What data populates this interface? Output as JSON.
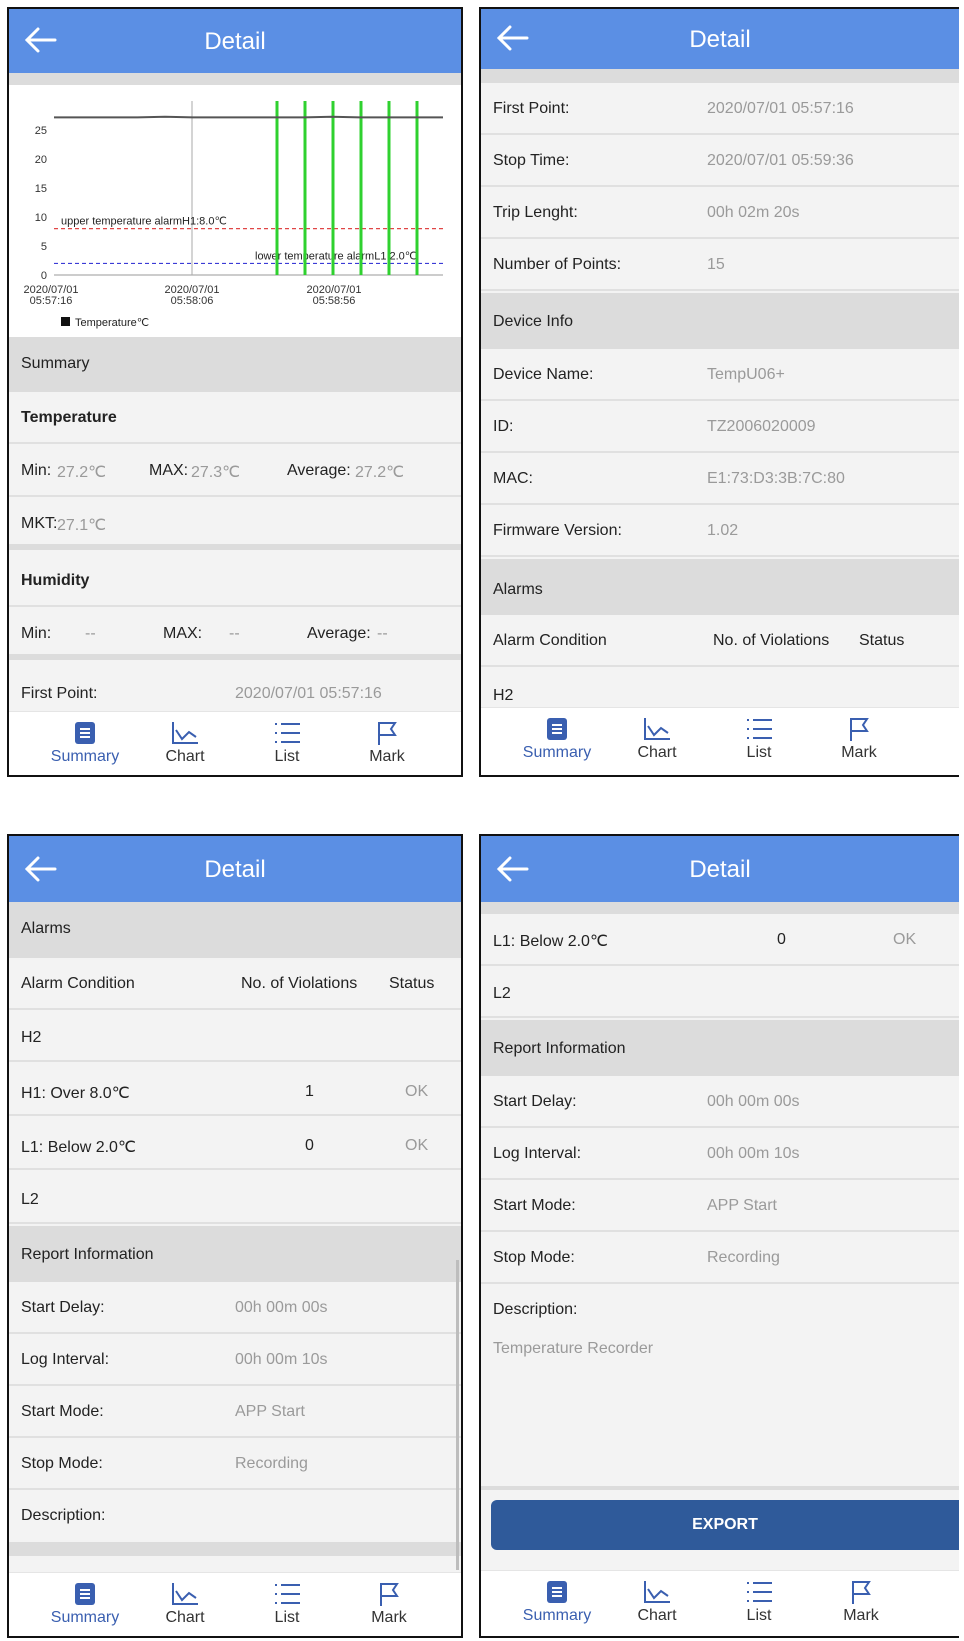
{
  "header": {
    "title": "Detail"
  },
  "nav": {
    "summary": "Summary",
    "chart": "Chart",
    "list": "List",
    "mark": "Mark"
  },
  "chart_data": {
    "type": "line",
    "title": "",
    "xlabel": "",
    "ylabel": "",
    "ylim": [
      0,
      29
    ],
    "yticks": [
      "25",
      "20",
      "15",
      "10",
      "5",
      "0"
    ],
    "xtick_labels": [
      [
        "2020/07/01",
        "05:57:16"
      ],
      [
        "2020/07/01",
        "05:58:06"
      ],
      [
        "2020/07/01",
        "05:58:56"
      ]
    ],
    "series": [
      {
        "name": "Temperature℃",
        "color": "#555555",
        "values": [
          27.2,
          27.2,
          27.2,
          27.2,
          27.3,
          27.2,
          27.2,
          27.2,
          27.2,
          27.2,
          27.3,
          27.2,
          27.2,
          27.2,
          27.2
        ]
      }
    ],
    "alarm_lines": [
      {
        "label": "upper temperature alarmH1:8.0℃",
        "value": 8.0,
        "color": "#e04646"
      },
      {
        "label": "lower temperature alarmL1:2.0℃",
        "value": 2.0,
        "color": "#3b3bd6"
      }
    ],
    "mark_count": 6,
    "mark_color": "#2fd12f",
    "legend": "Temperature℃",
    "legend_position": "bottom-left",
    "grid": false
  },
  "summary": {
    "section": "Summary",
    "temperature": {
      "heading": "Temperature",
      "min_label": "Min:",
      "min": "27.2℃",
      "max_label": "MAX:",
      "max": "27.3℃",
      "avg_label": "Average:",
      "avg": "27.2℃",
      "mkt_label": "MKT:",
      "mkt": "27.1℃"
    },
    "humidity": {
      "heading": "Humidity",
      "min_label": "Min:",
      "min": "--",
      "max_label": "MAX:",
      "max": "--",
      "avg_label": "Average:",
      "avg": "--"
    },
    "first_point_label": "First Point:",
    "first_point": "2020/07/01 05:57:16"
  },
  "trip": {
    "first_point_label": "First Point:",
    "first_point": "2020/07/01 05:57:16",
    "stop_time_label": "Stop Time:",
    "stop_time": "2020/07/01 05:59:36",
    "trip_length_label": "Trip Lenght:",
    "trip_length": "00h 02m 20s",
    "points_label": "Number of Points:",
    "points": "15"
  },
  "device": {
    "section": "Device Info",
    "name_label": "Device Name:",
    "name": "TempU06+",
    "id_label": "ID:",
    "id": "TZ2006020009",
    "mac_label": "MAC:",
    "mac": "E1:73:D3:3B:7C:80",
    "fw_label": "Firmware Version:",
    "fw": "1.02"
  },
  "alarms": {
    "section": "Alarms",
    "col_condition": "Alarm Condition",
    "col_violations": "No. of Violations",
    "col_status": "Status",
    "h2": "H2",
    "h2_cut": "H2",
    "h1": {
      "label": "H1: Over 8.0℃",
      "count": "1",
      "status": "OK"
    },
    "l1": {
      "label": "L1: Below 2.0℃",
      "count": "0",
      "status": "OK"
    },
    "l2": "L2"
  },
  "report": {
    "section": "Report Information",
    "start_delay_label": "Start Delay:",
    "start_delay": "00h 00m 00s",
    "log_interval_label": "Log Interval:",
    "log_interval": "00h 00m 10s",
    "start_mode_label": "Start Mode:",
    "start_mode": "APP Start",
    "stop_mode_label": "Stop Mode:",
    "stop_mode": "Recording",
    "description_label": "Description:",
    "description": "Temperature Recorder"
  },
  "export_label": "EXPORT"
}
